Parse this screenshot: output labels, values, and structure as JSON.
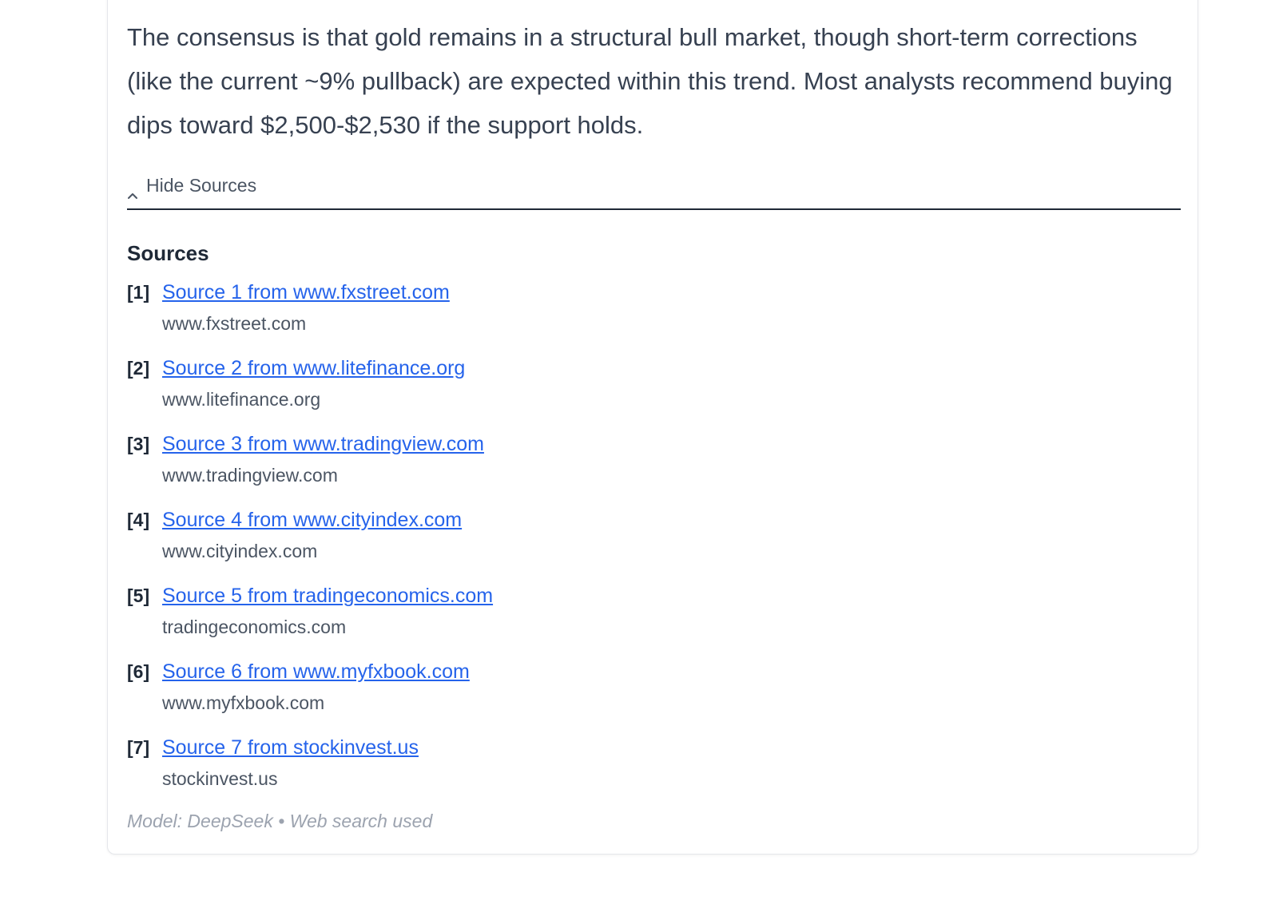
{
  "answer": {
    "text": "The consensus is that gold remains in a structural bull market, though short-term corrections (like the current ~9% pullback) are expected within this trend. Most analysts recommend buying dips toward $2,500-$2,530 if the support holds."
  },
  "sources_toggle": {
    "label": "Hide Sources",
    "icon": "chevron-up-icon"
  },
  "sources": {
    "heading": "Sources",
    "items": [
      {
        "num": "[1]",
        "link": "Source 1 from www.fxstreet.com",
        "domain": "www.fxstreet.com"
      },
      {
        "num": "[2]",
        "link": "Source 2 from www.litefinance.org",
        "domain": "www.litefinance.org"
      },
      {
        "num": "[3]",
        "link": "Source 3 from www.tradingview.com",
        "domain": "www.tradingview.com"
      },
      {
        "num": "[4]",
        "link": "Source 4 from www.cityindex.com",
        "domain": "www.cityindex.com"
      },
      {
        "num": "[5]",
        "link": "Source 5 from tradingeconomics.com",
        "domain": "tradingeconomics.com"
      },
      {
        "num": "[6]",
        "link": "Source 6 from www.myfxbook.com",
        "domain": "www.myfxbook.com"
      },
      {
        "num": "[7]",
        "link": "Source 7 from stockinvest.us",
        "domain": "stockinvest.us"
      }
    ]
  },
  "footer": {
    "text": "Model: DeepSeek • Web search used"
  },
  "colors": {
    "link": "#2563eb",
    "text": "#374151",
    "muted": "#9ca3af",
    "divider": "#1f2937"
  }
}
